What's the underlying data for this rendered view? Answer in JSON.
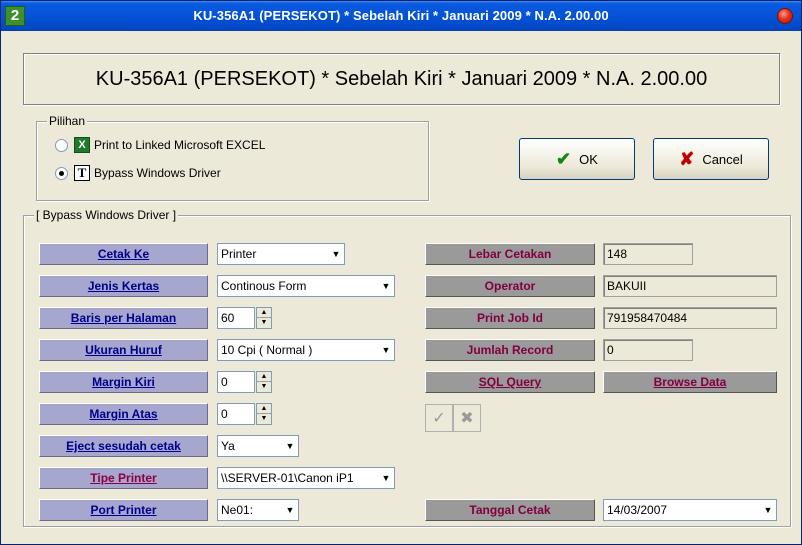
{
  "window": {
    "title": "KU-356A1 (PERSEKOT) * Sebelah Kiri * Januari 2009 * N.A. 2.00.00",
    "app_icon": "2"
  },
  "header": {
    "title": "KU-356A1 (PERSEKOT) * Sebelah Kiri * Januari 2009 * N.A. 2.00.00"
  },
  "pilihan": {
    "legend": "Pilihan",
    "options": [
      {
        "label": "Print to Linked Microsoft EXCEL",
        "selected": false,
        "icon": "excel-icon"
      },
      {
        "label": "Bypass Windows Driver",
        "selected": true,
        "icon": "t-icon"
      }
    ]
  },
  "buttons": {
    "ok": "OK",
    "cancel": "Cancel"
  },
  "bypass": {
    "legend": "[ Bypass Windows Driver ]",
    "left": [
      {
        "label": "Cetak Ke",
        "value": "Printer",
        "control": "dropdown"
      },
      {
        "label": "Jenis Kertas",
        "value": "Continous Form",
        "control": "dropdown"
      },
      {
        "label": "Baris per Halaman",
        "value": "60",
        "control": "spin"
      },
      {
        "label": "Ukuran Huruf",
        "value": "10 Cpi ( Normal )",
        "control": "dropdown"
      },
      {
        "label": "Margin Kiri",
        "value": "0",
        "control": "spin"
      },
      {
        "label": "Margin Atas",
        "value": "0",
        "control": "spin"
      },
      {
        "label": "Eject sesudah cetak",
        "value": "Ya",
        "control": "dropdown"
      },
      {
        "label": "Tipe Printer",
        "value": "\\\\SERVER-01\\Canon iP1",
        "control": "dropdown"
      },
      {
        "label": "Port Printer",
        "value": "Ne01:",
        "control": "dropdown"
      }
    ],
    "right": {
      "lebar_cetakan": {
        "label": "Lebar Cetakan",
        "value": "148"
      },
      "operator": {
        "label": "Operator",
        "value": "BAKUII"
      },
      "print_job_id": {
        "label": "Print Job Id",
        "value": "791958470484"
      },
      "jumlah_record": {
        "label": "Jumlah Record",
        "value": "0"
      },
      "sql_query": {
        "label": "SQL Query"
      },
      "browse_data": {
        "label": "Browse Data"
      },
      "tanggal_cetak": {
        "label": "Tanggal Cetak",
        "value": "14/03/2007"
      }
    }
  },
  "colors": {
    "titlebar": "#0553d6",
    "label_bg": "#a6a6ce",
    "label_text": "#00008b",
    "accent_label_text": "#8b0040"
  }
}
